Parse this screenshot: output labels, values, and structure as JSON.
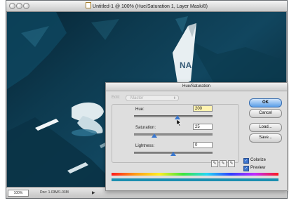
{
  "window": {
    "title": "Untitled-1 @ 100% (Hue/Saturation 1, Layer Mask/8)",
    "zoom": "100%",
    "doc_info": "Doc: 1.03M/1.03M"
  },
  "dialog": {
    "title": "Hue/Saturation",
    "edit_label": "Edit:",
    "edit_value": "Master",
    "hue_label": "Hue:",
    "hue_value": "200",
    "saturation_label": "Saturation:",
    "saturation_value": "25",
    "lightness_label": "Lightness:",
    "lightness_value": "0",
    "buttons": {
      "ok": "OK",
      "cancel": "Cancel",
      "load": "Load...",
      "save": "Save..."
    },
    "colorize_label": "Colorize",
    "colorize_checked": true,
    "preview_label": "Preview",
    "preview_checked": true,
    "colors": {
      "accent": "#3a78d0",
      "colorized_bar": "#1c8fb0"
    }
  },
  "photo": {
    "tail_lettering": "NA"
  }
}
